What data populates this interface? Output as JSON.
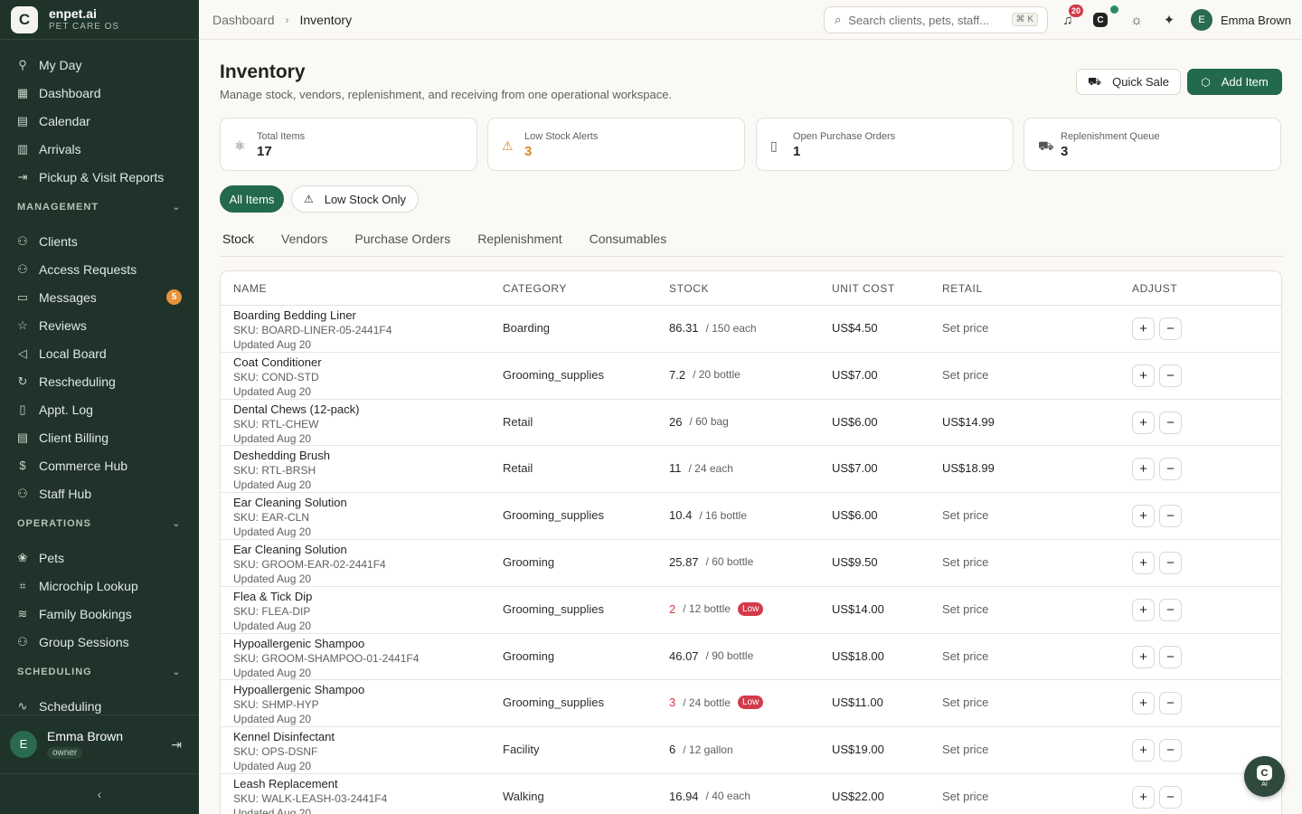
{
  "brand": {
    "name": "enpet.ai",
    "subtitle": "PET CARE OS",
    "logo_letter": "C"
  },
  "sidebar": {
    "top_items": [
      {
        "label": "My Day",
        "icon": "person-walk-icon"
      },
      {
        "label": "Dashboard",
        "icon": "grid-icon"
      },
      {
        "label": "Calendar",
        "icon": "calendar-icon"
      },
      {
        "label": "Arrivals",
        "icon": "building-icon"
      },
      {
        "label": "Pickup & Visit Reports",
        "icon": "exit-icon"
      }
    ],
    "management": {
      "title": "MANAGEMENT",
      "items": [
        {
          "label": "Clients"
        },
        {
          "label": "Access Requests"
        },
        {
          "label": "Messages",
          "badge": "5"
        },
        {
          "label": "Reviews"
        },
        {
          "label": "Local Board"
        },
        {
          "label": "Rescheduling"
        },
        {
          "label": "Appt. Log"
        },
        {
          "label": "Client Billing"
        },
        {
          "label": "Commerce Hub"
        },
        {
          "label": "Staff Hub"
        }
      ]
    },
    "operations": {
      "title": "OPERATIONS",
      "items": [
        {
          "label": "Pets"
        },
        {
          "label": "Microchip Lookup"
        },
        {
          "label": "Family Bookings"
        },
        {
          "label": "Group Sessions"
        }
      ]
    },
    "scheduling": {
      "title": "SCHEDULING",
      "items": [
        {
          "label": "Scheduling"
        }
      ]
    },
    "user": {
      "initial": "E",
      "name": "Emma Brown",
      "role": "owner"
    }
  },
  "topbar": {
    "breadcrumb": [
      "Dashboard",
      "Inventory"
    ],
    "search_placeholder": "Search clients, pets, staff...",
    "search_shortcut": "⌘ K",
    "notifications_count": "20",
    "user": {
      "initial": "E",
      "name": "Emma Brown"
    }
  },
  "page": {
    "title": "Inventory",
    "subtitle": "Manage stock, vendors, replenishment, and receiving from one operational workspace.",
    "quick_sale_label": "Quick Sale",
    "add_item_label": "Add Item"
  },
  "stats": [
    {
      "label": "Total Items",
      "value": "17"
    },
    {
      "label": "Low Stock Alerts",
      "value": "3"
    },
    {
      "label": "Open Purchase Orders",
      "value": "1"
    },
    {
      "label": "Replenishment Queue",
      "value": "3"
    }
  ],
  "filters": {
    "all_label": "All Items",
    "low_label": "Low Stock Only"
  },
  "tabs": [
    "Stock",
    "Vendors",
    "Purchase Orders",
    "Replenishment",
    "Consumables"
  ],
  "table": {
    "headers": [
      "NAME",
      "CATEGORY",
      "STOCK",
      "UNIT COST",
      "RETAIL",
      "ADJUST"
    ],
    "rows": [
      {
        "name": "Boarding Bedding Liner",
        "sku": "SKU: BOARD-LINER-05-2441F4",
        "updated": "Updated Aug 20",
        "category": "Boarding",
        "stock": "86.31",
        "capacity": "/ 150 each",
        "low": false,
        "unit_cost": "US$4.50",
        "retail": "Set price"
      },
      {
        "name": "Coat Conditioner",
        "sku": "SKU: COND-STD",
        "updated": "Updated Aug 20",
        "category": "Grooming_supplies",
        "stock": "7.2",
        "capacity": "/ 20 bottle",
        "low": false,
        "unit_cost": "US$7.00",
        "retail": "Set price"
      },
      {
        "name": "Dental Chews (12-pack)",
        "sku": "SKU: RTL-CHEW",
        "updated": "Updated Aug 20",
        "category": "Retail",
        "stock": "26",
        "capacity": "/ 60 bag",
        "low": false,
        "unit_cost": "US$6.00",
        "retail": "US$14.99"
      },
      {
        "name": "Deshedding Brush",
        "sku": "SKU: RTL-BRSH",
        "updated": "Updated Aug 20",
        "category": "Retail",
        "stock": "11",
        "capacity": "/ 24 each",
        "low": false,
        "unit_cost": "US$7.00",
        "retail": "US$18.99"
      },
      {
        "name": "Ear Cleaning Solution",
        "sku": "SKU: EAR-CLN",
        "updated": "Updated Aug 20",
        "category": "Grooming_supplies",
        "stock": "10.4",
        "capacity": "/ 16 bottle",
        "low": false,
        "unit_cost": "US$6.00",
        "retail": "Set price"
      },
      {
        "name": "Ear Cleaning Solution",
        "sku": "SKU: GROOM-EAR-02-2441F4",
        "updated": "Updated Aug 20",
        "category": "Grooming",
        "stock": "25.87",
        "capacity": "/ 60 bottle",
        "low": false,
        "unit_cost": "US$9.50",
        "retail": "Set price"
      },
      {
        "name": "Flea & Tick Dip",
        "sku": "SKU: FLEA-DIP",
        "updated": "Updated Aug 20",
        "category": "Grooming_supplies",
        "stock": "2",
        "capacity": "/ 12 bottle",
        "low": true,
        "low_label": "Low",
        "unit_cost": "US$14.00",
        "retail": "Set price"
      },
      {
        "name": "Hypoallergenic Shampoo",
        "sku": "SKU: GROOM-SHAMPOO-01-2441F4",
        "updated": "Updated Aug 20",
        "category": "Grooming",
        "stock": "46.07",
        "capacity": "/ 90 bottle",
        "low": false,
        "unit_cost": "US$18.00",
        "retail": "Set price"
      },
      {
        "name": "Hypoallergenic Shampoo",
        "sku": "SKU: SHMP-HYP",
        "updated": "Updated Aug 20",
        "category": "Grooming_supplies",
        "stock": "3",
        "capacity": "/ 24 bottle",
        "low": true,
        "low_label": "Low",
        "unit_cost": "US$11.00",
        "retail": "Set price"
      },
      {
        "name": "Kennel Disinfectant",
        "sku": "SKU: OPS-DSNF",
        "updated": "Updated Aug 20",
        "category": "Facility",
        "stock": "6",
        "capacity": "/ 12 gallon",
        "low": false,
        "unit_cost": "US$19.00",
        "retail": "Set price"
      },
      {
        "name": "Leash Replacement",
        "sku": "SKU: WALK-LEASH-03-2441F4",
        "updated": "Updated Aug 20",
        "category": "Walking",
        "stock": "16.94",
        "capacity": "/ 40 each",
        "low": false,
        "unit_cost": "US$22.00",
        "retail": "Set price"
      }
    ]
  },
  "ai_button": {
    "label": "AI"
  },
  "colors": {
    "sidebar": "#1f332a",
    "accent": "#23694c",
    "danger": "#d43a49",
    "warning": "#d98a1f"
  }
}
